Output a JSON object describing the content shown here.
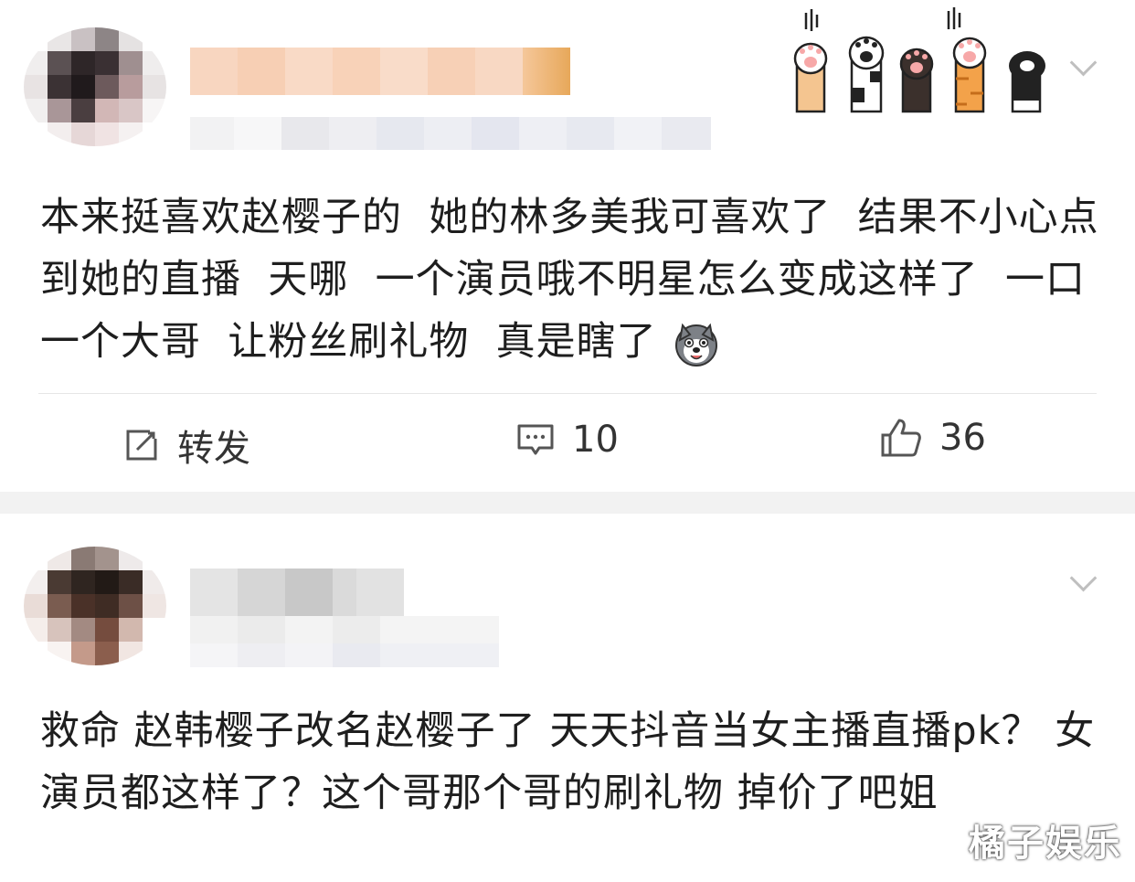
{
  "posts": [
    {
      "text": "本来挺喜欢赵樱子的  她的林多美我可喜欢了  结果不小心点到她的直播  天哪  一个演员哦不明星怎么变成这样了  一口一个大哥  让粉丝刷礼物  真是瞎了",
      "emoji": "husky-dog-emoji",
      "actions": {
        "repost_label": "转发",
        "comment_count": "10",
        "like_count": "36"
      }
    },
    {
      "text": "救命 赵韩樱子改名赵樱子了 天天抖音当女主播直播pk？ 女演员都这样了？这个哥那个哥的刷礼物 掉价了吧姐"
    }
  ],
  "watermark": "橘子娱乐",
  "icons": [
    "more-chevron-icon",
    "cat-paws-decoration",
    "repost-icon",
    "comment-icon",
    "like-icon"
  ],
  "colors": {
    "text": "#1e1e1e",
    "muted": "#bfbfbf",
    "band": "#f2f2f2",
    "name_blur": "#f6cba8"
  }
}
